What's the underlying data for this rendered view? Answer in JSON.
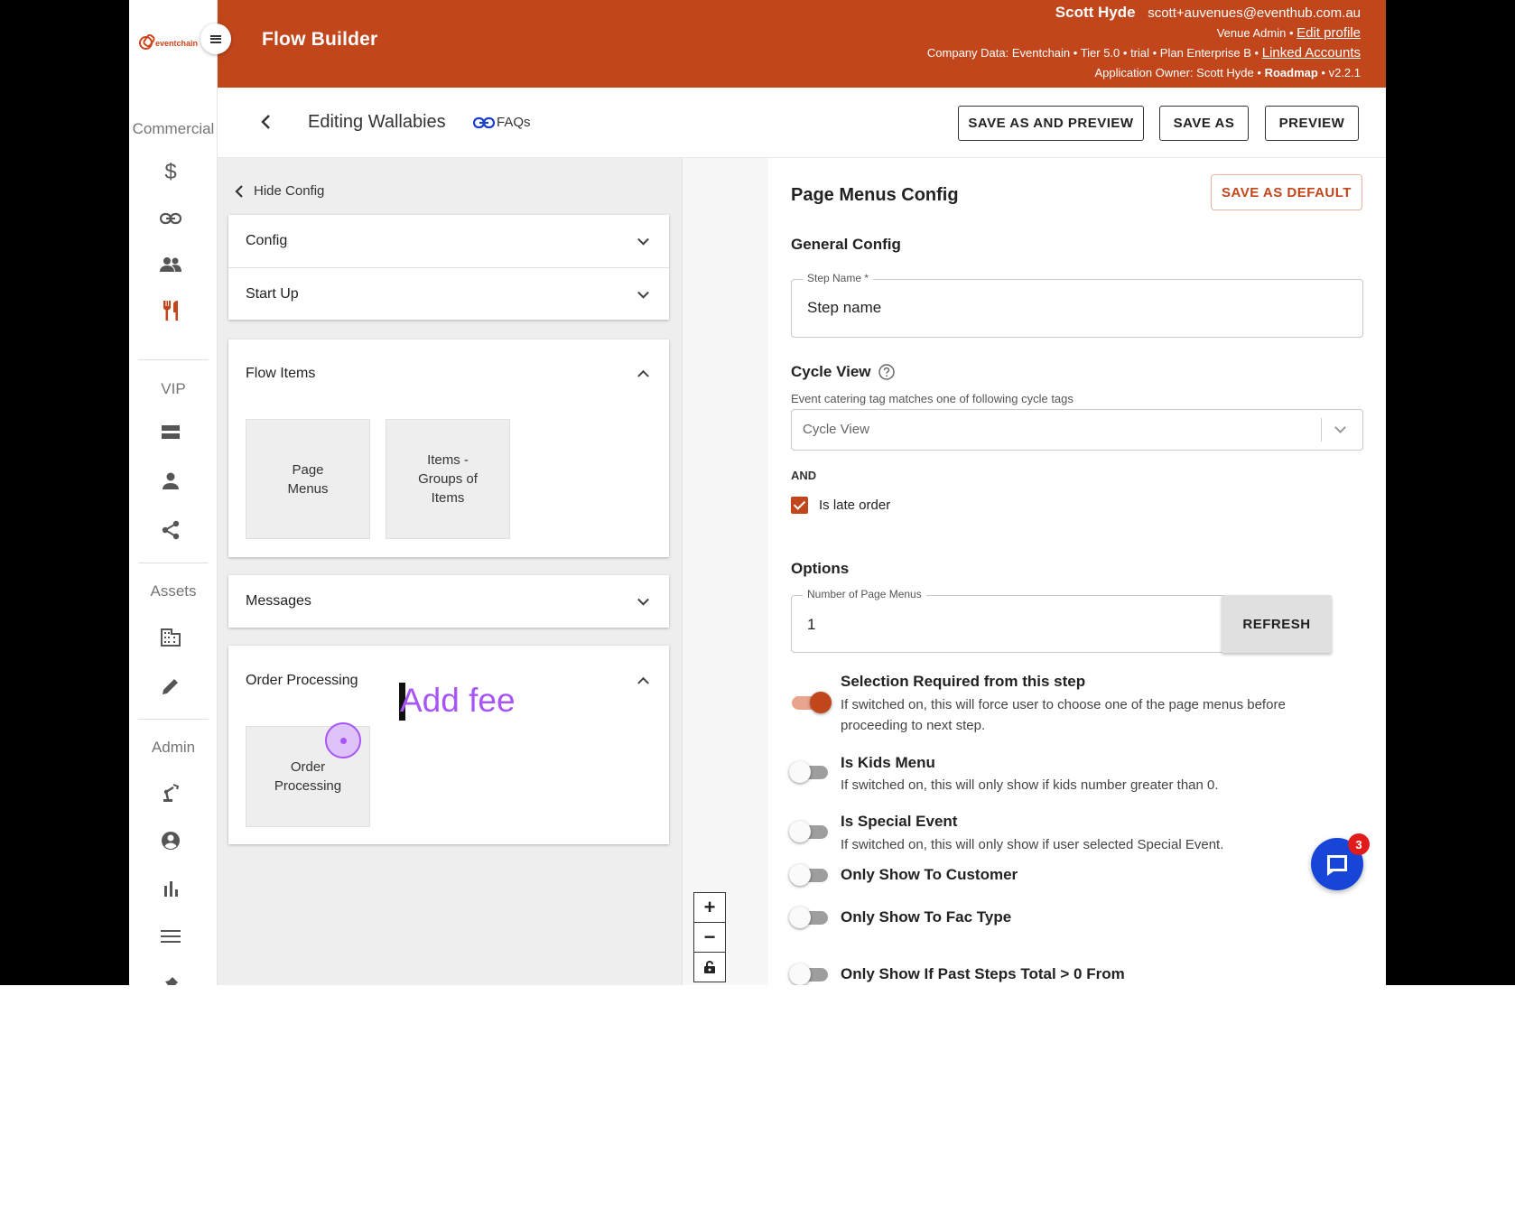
{
  "brand": {
    "logo_text": "eventchain",
    "accent": "#c1461b"
  },
  "header": {
    "title": "Flow Builder",
    "user_name": "Scott Hyde",
    "user_email": "scott+auvenues@eventhub.com.au",
    "role": "Venue Admin",
    "edit_profile": "Edit profile",
    "company_data": "Company Data: Eventchain • Tier 5.0 • trial • Plan Enterprise B •",
    "linked_accounts": "Linked Accounts",
    "app_owner": "Application Owner: Scott Hyde •",
    "roadmap": "Roadmap",
    "version": "• v2.2.1"
  },
  "sidebar": {
    "sections": [
      {
        "label": "Commercial",
        "icons": [
          "dollar-icon",
          "link-icon",
          "group-icon",
          "restaurant-icon"
        ]
      },
      {
        "label": "VIP",
        "icons": [
          "storage-icon",
          "person-icon",
          "share-icon"
        ]
      },
      {
        "label": "Assets",
        "icons": [
          "building-icon",
          "pencil-icon"
        ]
      },
      {
        "label": "Admin",
        "icons": [
          "robot-arm-icon",
          "account-circle-icon",
          "bar-chart-icon",
          "list-icon",
          "pin-icon"
        ]
      }
    ],
    "active_icon": "restaurant-icon"
  },
  "toolbar": {
    "editing_title": "Editing Wallabies",
    "faqs": "FAQs",
    "save_as_preview": "SAVE AS AND PREVIEW",
    "save_as": "SAVE AS",
    "preview": "PREVIEW"
  },
  "config_panel": {
    "hide_config": "Hide Config",
    "config": "Config",
    "start_up": "Start Up",
    "flow_items": "Flow Items",
    "page_menus_tile": "Page\nMenus",
    "items_groups_tile": "Items -\nGroups of\nItems",
    "messages": "Messages",
    "order_processing": "Order Processing",
    "order_processing_tile": "Order\nProcessing"
  },
  "canvas": {
    "zoom_in": "+",
    "zoom_out": "−"
  },
  "form": {
    "title": "Page Menus Config",
    "save_default": "SAVE AS DEFAULT",
    "general_config": "General Config",
    "step_name_label": "Step Name *",
    "step_name_value": "Step name",
    "cycle_view": "Cycle View",
    "cycle_hint": "Event catering tag matches one of following cycle tags",
    "cycle_placeholder": "Cycle View",
    "and": "AND",
    "late_order": "Is late order",
    "late_order_checked": true,
    "options": "Options",
    "num_menus_label": "Number of Page Menus",
    "num_menus_value": "1",
    "refresh": "REFRESH",
    "toggles": [
      {
        "title": "Selection Required from this step",
        "desc": "If switched on, this will force user to choose one of the page menus before proceeding to next step.",
        "on": true
      },
      {
        "title": "Is Kids Menu",
        "desc": "If switched on, this will only show if kids number greater than 0.",
        "on": false
      },
      {
        "title": "Is Special Event",
        "desc": "If switched on, this will only show if user selected Special Event.",
        "on": false
      },
      {
        "title": "Only Show To Customer",
        "desc": "",
        "on": false
      },
      {
        "title": "Only Show To Fac Type",
        "desc": "",
        "on": false
      },
      {
        "title": "Only Show If Past Steps Total > 0 From",
        "desc": "",
        "on": false
      }
    ]
  },
  "chat": {
    "badge": "3"
  },
  "overlay": {
    "typed_text": "Add fee"
  }
}
